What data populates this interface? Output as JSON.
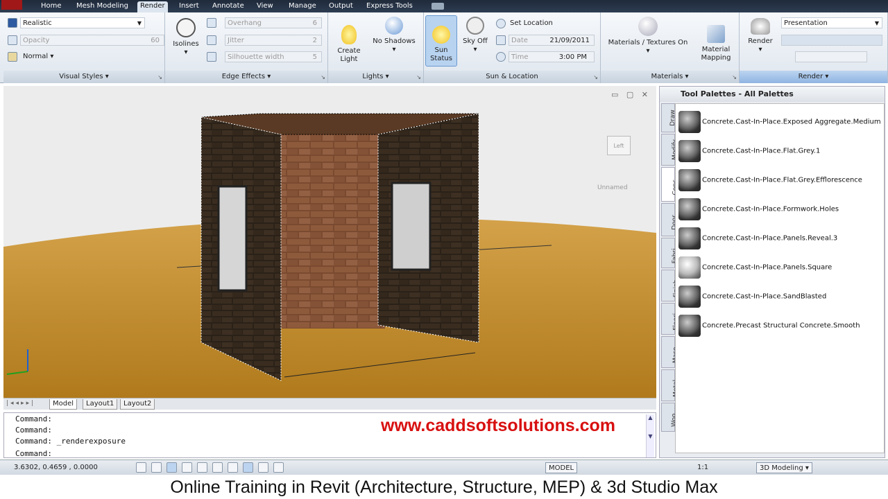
{
  "tabs": [
    "Home",
    "Mesh Modeling",
    "Render",
    "Insert",
    "Annotate",
    "View",
    "Manage",
    "Output",
    "Express Tools"
  ],
  "active_tab": "Render",
  "visual_styles": {
    "style_value": "Realistic",
    "opacity_label": "Opacity",
    "opacity_value": "60",
    "mode_value": "Normal",
    "title": "Visual Styles"
  },
  "edge_effects": {
    "isolines_label": "Isolines",
    "overhang_label": "Overhang",
    "overhang_value": "6",
    "jitter_label": "Jitter",
    "jitter_value": "2",
    "silhouette_label": "Silhouette width",
    "silhouette_value": "5",
    "title": "Edge Effects"
  },
  "lights": {
    "create_light_label": "Create\nLight",
    "no_shadows_label": "No Shadows",
    "title": "Lights"
  },
  "sun_location": {
    "sun_status_label": "Sun\nStatus",
    "sky_off_label": "Sky Off",
    "set_location_label": "Set Location",
    "date_label": "Date",
    "date_value": "21/09/2011",
    "time_label": "Time",
    "time_value": "3:00 PM",
    "title": "Sun & Location"
  },
  "materials": {
    "materials_textures_label": "Materials / Textures On",
    "material_mapping_label": "Material\nMapping",
    "title": "Materials"
  },
  "render": {
    "render_label": "Render",
    "preset_value": "Presentation",
    "title": "Render"
  },
  "viewport": {
    "viewcube_label": "Left",
    "wcs_label": "Unnamed"
  },
  "layout_tabs": [
    "Model",
    "Layout1",
    "Layout2"
  ],
  "command_lines": [
    "Command:",
    "Command:",
    "Command: _renderexposure",
    "Command:"
  ],
  "website": "www.caddsoftsolutions.com",
  "status": {
    "coords": "3.6302,  0.4659  , 0.0000",
    "model_label": "MODEL",
    "scale_label": "1:1",
    "workspace_value": "3D Modeling"
  },
  "palette": {
    "title": "Tool Palettes - All Palettes",
    "vtabs": [
      "Draw",
      "Modify",
      "Conc...",
      "Door...",
      "Fabri...",
      "Finish...",
      "Floori...",
      "Maso...",
      "Metal...",
      "Woo..."
    ],
    "items": [
      "Concrete.Cast-In-Place.Exposed Aggregate.Medium",
      "Concrete.Cast-In-Place.Flat.Grey.1",
      "Concrete.Cast-In-Place.Flat.Grey.Efflorescence",
      "Concrete.Cast-In-Place.Formwork.Holes",
      "Concrete.Cast-In-Place.Panels.Reveal.3",
      "Concrete.Cast-In-Place.Panels.Square",
      "Concrete.Cast-In-Place.SandBlasted",
      "Concrete.Precast Structural Concrete.Smooth"
    ]
  },
  "caption": "Online Training in Revit (Architecture, Structure, MEP) & 3d Studio Max"
}
